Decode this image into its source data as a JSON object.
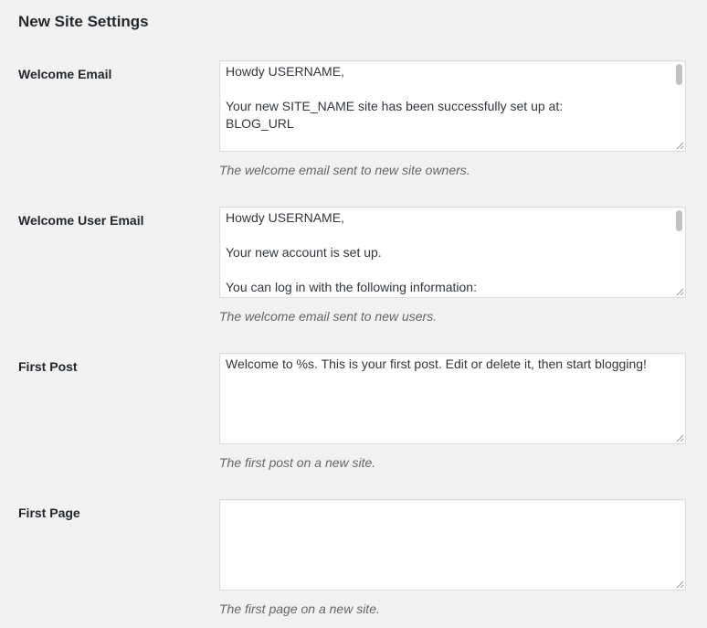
{
  "page": {
    "heading": "New Site Settings"
  },
  "fields": {
    "welcome_email": {
      "label": "Welcome Email",
      "value": "Howdy USERNAME,\n\nYour new SITE_NAME site has been successfully set up at:\nBLOG_URL",
      "description": "The welcome email sent to new site owners."
    },
    "welcome_user_email": {
      "label": "Welcome User Email",
      "value": "Howdy USERNAME,\n\nYour new account is set up.\n\nYou can log in with the following information:",
      "description": "The welcome email sent to new users."
    },
    "first_post": {
      "label": "First Post",
      "value": "Welcome to %s. This is your first post. Edit or delete it, then start blogging!",
      "description": "The first post on a new site."
    },
    "first_page": {
      "label": "First Page",
      "value": "",
      "description": "The first page on a new site."
    }
  },
  "icons": {
    "scrollbar": "scrollbar-thumb-icon",
    "resize": "resize-handle-icon"
  }
}
